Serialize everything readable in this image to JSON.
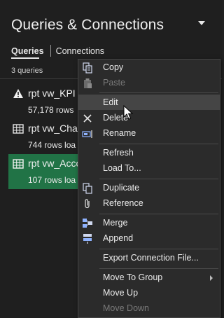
{
  "pane": {
    "title": "Queries & Connections",
    "tabs": [
      {
        "label": "Queries",
        "active": true
      },
      {
        "label": "Connections",
        "active": false
      }
    ],
    "query_count": "3 queries"
  },
  "queries": [
    {
      "name": "rpt vw_KPI",
      "sub": "57,178 rows",
      "icon": "warning-icon",
      "selected": false
    },
    {
      "name": "rpt vw_Cha",
      "sub": "744 rows loa",
      "icon": "table-icon",
      "selected": false
    },
    {
      "name": "rpt vw_Acco",
      "sub": "107 rows loa",
      "icon": "table-icon",
      "selected": true
    }
  ],
  "context_menu": {
    "items": {
      "copy": "Copy",
      "paste": "Paste",
      "edit": "Edit",
      "delete": "Delete",
      "rename": "Rename",
      "refresh": "Refresh",
      "load_to": "Load To...",
      "duplicate": "Duplicate",
      "reference": "Reference",
      "merge": "Merge",
      "append": "Append",
      "export": "Export Connection File...",
      "move_to_group": "Move To Group",
      "move_up": "Move Up",
      "move_down": "Move Down"
    },
    "hovered": "Edit",
    "disabled": [
      "Paste",
      "Move Down"
    ]
  },
  "colors": {
    "background": "#1f1f1f",
    "selected": "#217346",
    "menu_bg": "#2b2b2b",
    "menu_hover": "#454545"
  }
}
